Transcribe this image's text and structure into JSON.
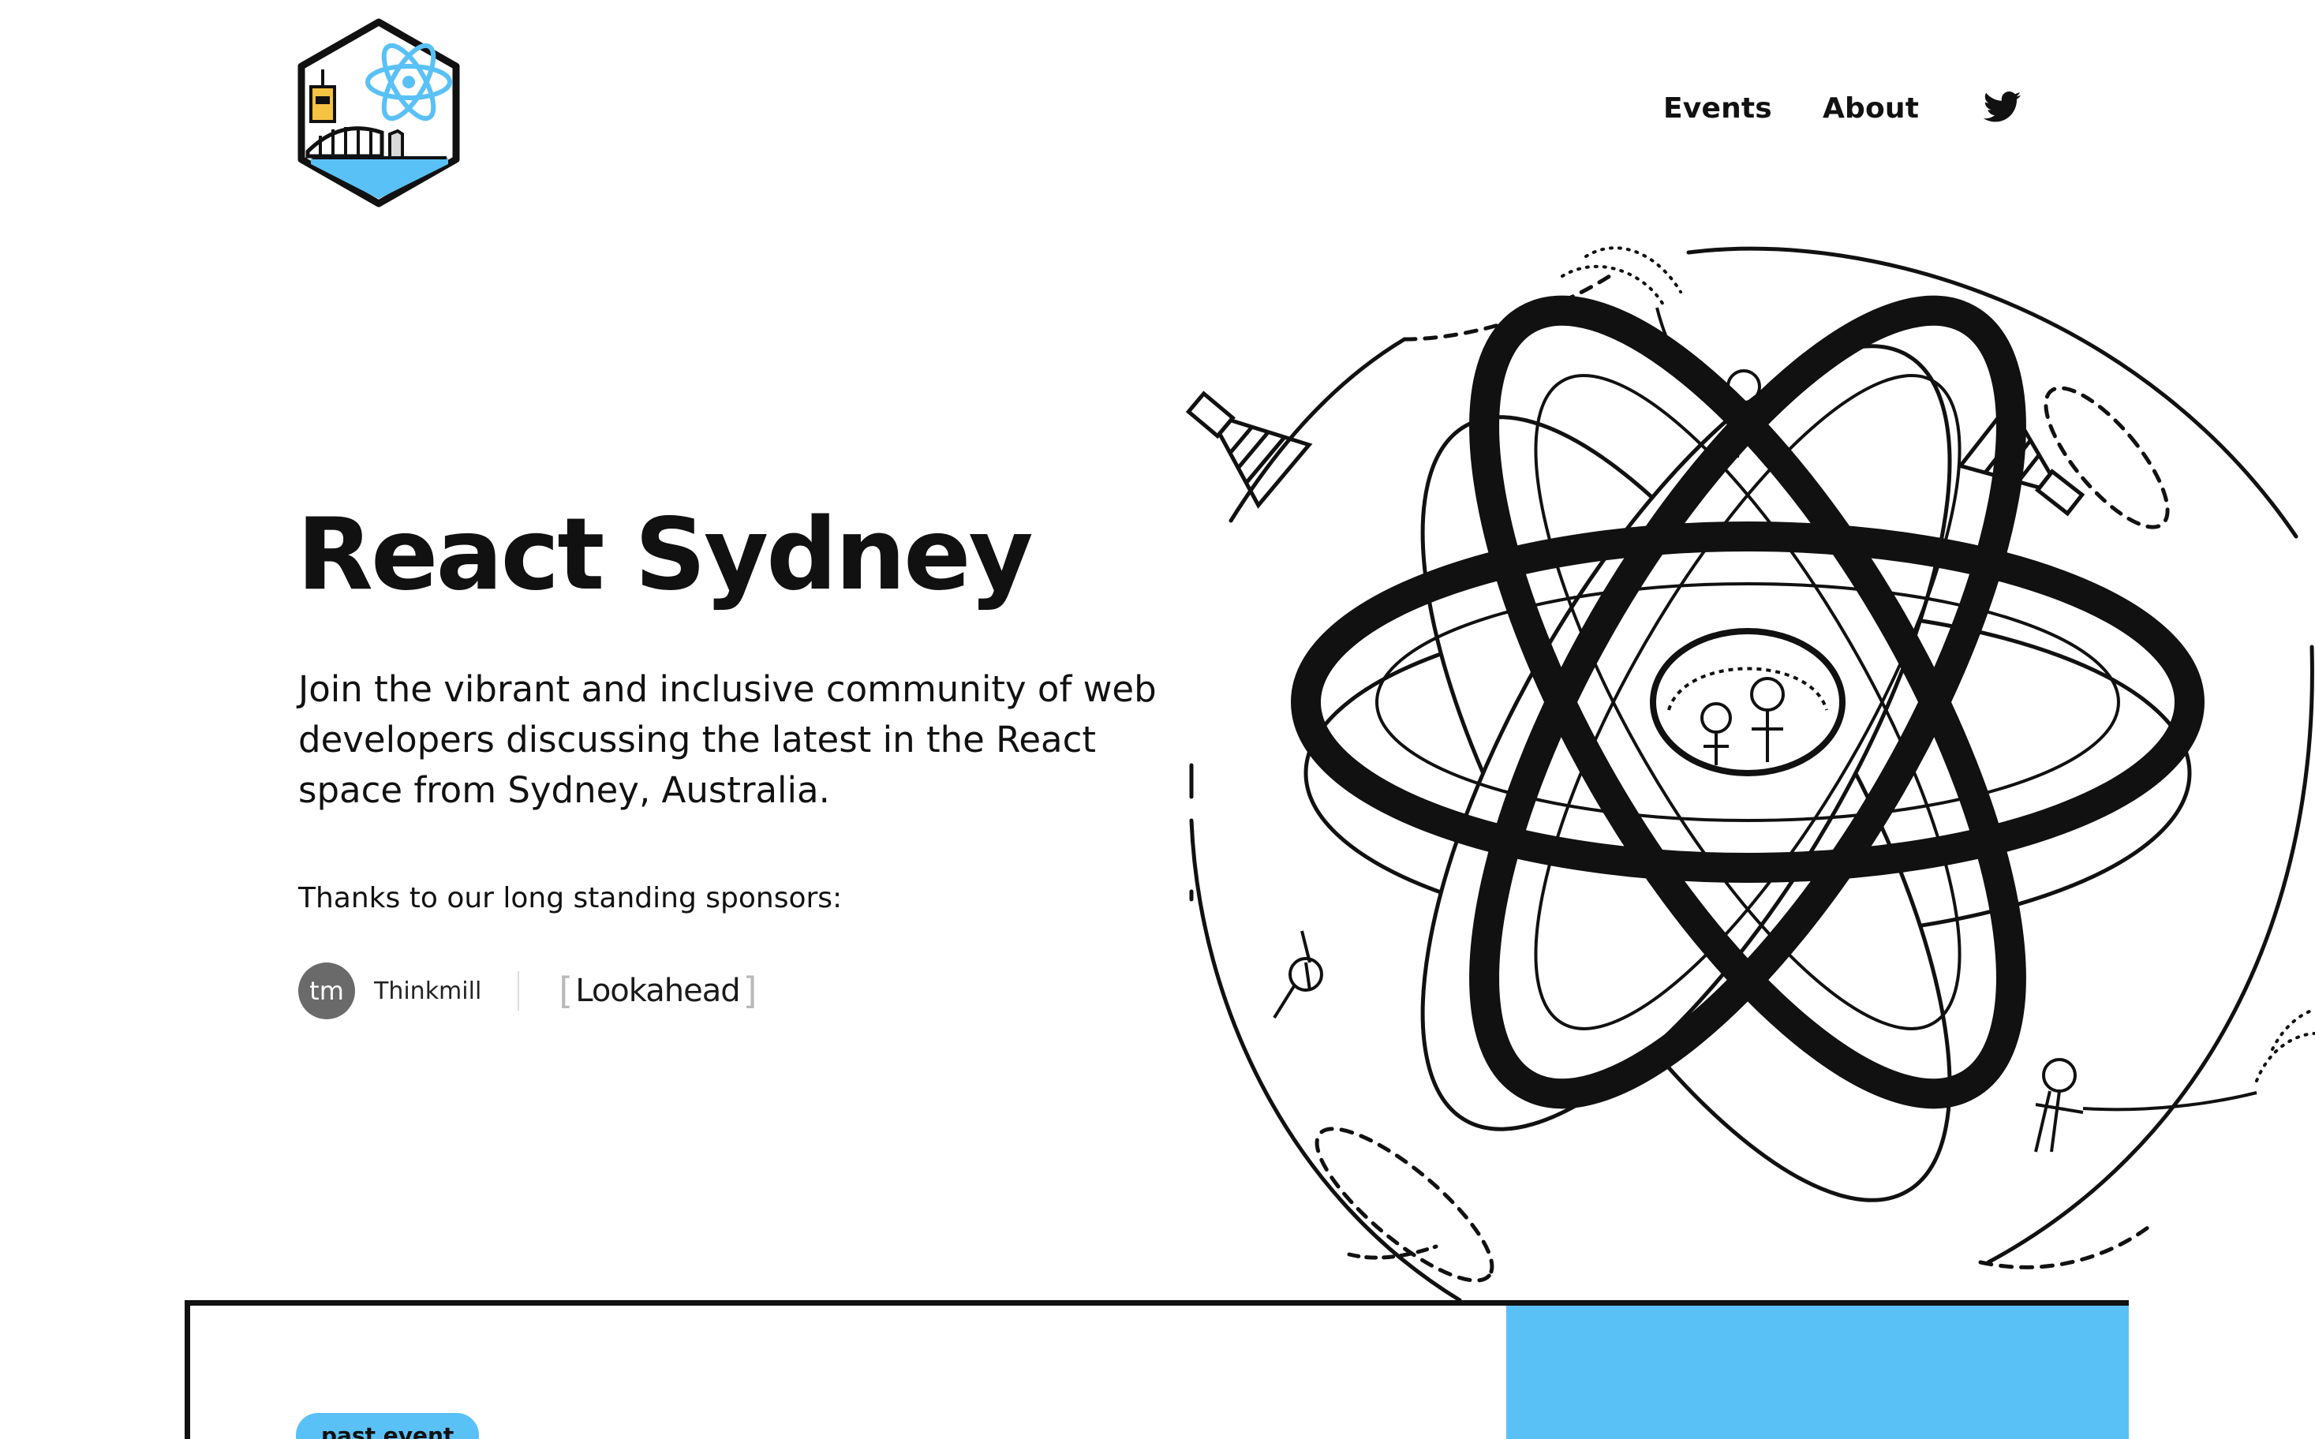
{
  "nav": {
    "events_label": "Events",
    "about_label": "About",
    "twitter_icon": "twitter-icon"
  },
  "logo": {
    "icon": "react-sydney-hexagon-logo"
  },
  "hero": {
    "title": "React Sydney",
    "description": "Join the vibrant and inclusive community of web developers discussing the latest in the React space from Sydney, Australia.",
    "sponsors_label": "Thanks to our long standing sponsors:"
  },
  "sponsors": [
    {
      "badge": "tm",
      "name": "Thinkmill"
    },
    {
      "name": "Lookahead"
    }
  ],
  "event": {
    "badge": "past event"
  },
  "colors": {
    "accent": "#5ac1f6",
    "text": "#111111",
    "sponsor_badge": "#6a6a6a"
  }
}
